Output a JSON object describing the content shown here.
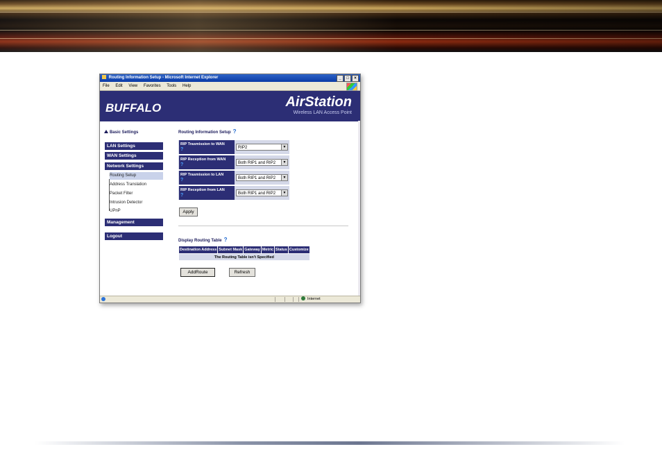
{
  "window": {
    "title": "Routing Information Setup - Microsoft Internet Explorer",
    "controls": [
      "_",
      "□",
      "×"
    ],
    "menu": [
      "File",
      "Edit",
      "View",
      "Favorites",
      "Tools",
      "Help"
    ]
  },
  "header": {
    "brand": "BUFFALO",
    "product": "AirStation",
    "product_sub": "Wireless LAN Access Point"
  },
  "sidebar": {
    "basic_settings": "Basic Settings",
    "lan": "LAN Settings",
    "wan": "WAN Settings",
    "network": "Network Settings",
    "sub": [
      "Routing Setup",
      "Address Translation",
      "Packet Filter",
      "Intrusion Detector",
      "UPnP"
    ],
    "active_sub": "Routing Setup",
    "management": "Management",
    "logout": "Logout"
  },
  "routing": {
    "title": "Routing Information Setup",
    "help": "?",
    "rows": [
      {
        "label": "RIP Trasmission to WAN",
        "value": "RIP2"
      },
      {
        "label": "RIP Reception from WAN",
        "value": "Both RIP1 and RIP2"
      },
      {
        "label": "RIP Trasmission to LAN",
        "value": "Both RIP1 and RIP2"
      },
      {
        "label": "RIP Reception from LAN",
        "value": "Both RIP1 and RIP2"
      }
    ],
    "apply": "Apply"
  },
  "table": {
    "title": "Display Routing Table",
    "columns": [
      "Destination Address",
      "Subnet Mask",
      "Gateway",
      "Metric",
      "Status",
      "Customize"
    ],
    "empty_message": "The Routing Table isn't Specified",
    "add_route": "AddRoute",
    "refresh": "Refresh"
  },
  "statusbar": {
    "zone": "Internet"
  }
}
